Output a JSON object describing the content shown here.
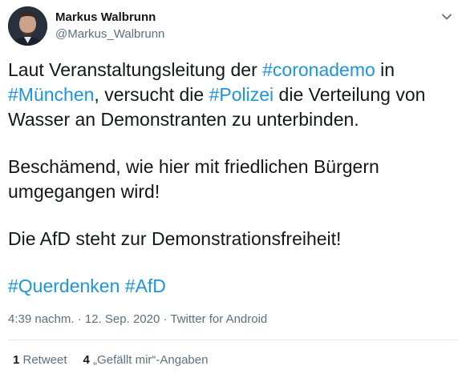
{
  "author": {
    "display_name": "Markus Walbrunn",
    "handle": "@Markus_Walbrunn"
  },
  "tweet": {
    "p1_a": "Laut Veranstaltungsleitung der ",
    "tag_coronademo": "#coronademo",
    "p1_b": " in",
    "tag_muenchen": "#München",
    "p1_c": ", versucht die ",
    "tag_polizei": "#Polizei",
    "p1_d": " die Verteilung von Wasser an Demonstranten zu unterbinden.",
    "p2": "Beschämend, wie hier mit friedlichen Bürgern umgegangen wird!",
    "p3": "Die AfD steht zur Demonstrationsfreiheit!",
    "tag_querdenken": "#Querdenken",
    "tag_afd": "#AfD"
  },
  "meta": {
    "time": "4:39 nachm.",
    "separator": " · ",
    "date": "12. Sep. 2020",
    "source": "Twitter for Android"
  },
  "stats": {
    "retweet_count": "1",
    "retweet_label": " Retweet",
    "likes_count": "4",
    "likes_label": " „Gefällt mir“-Angaben"
  },
  "colors": {
    "link": "#1b95e0",
    "secondary_text": "#5b7083",
    "primary_text": "#14171a"
  },
  "icons": {
    "caret": "chevron-down-icon",
    "avatar": "avatar"
  }
}
